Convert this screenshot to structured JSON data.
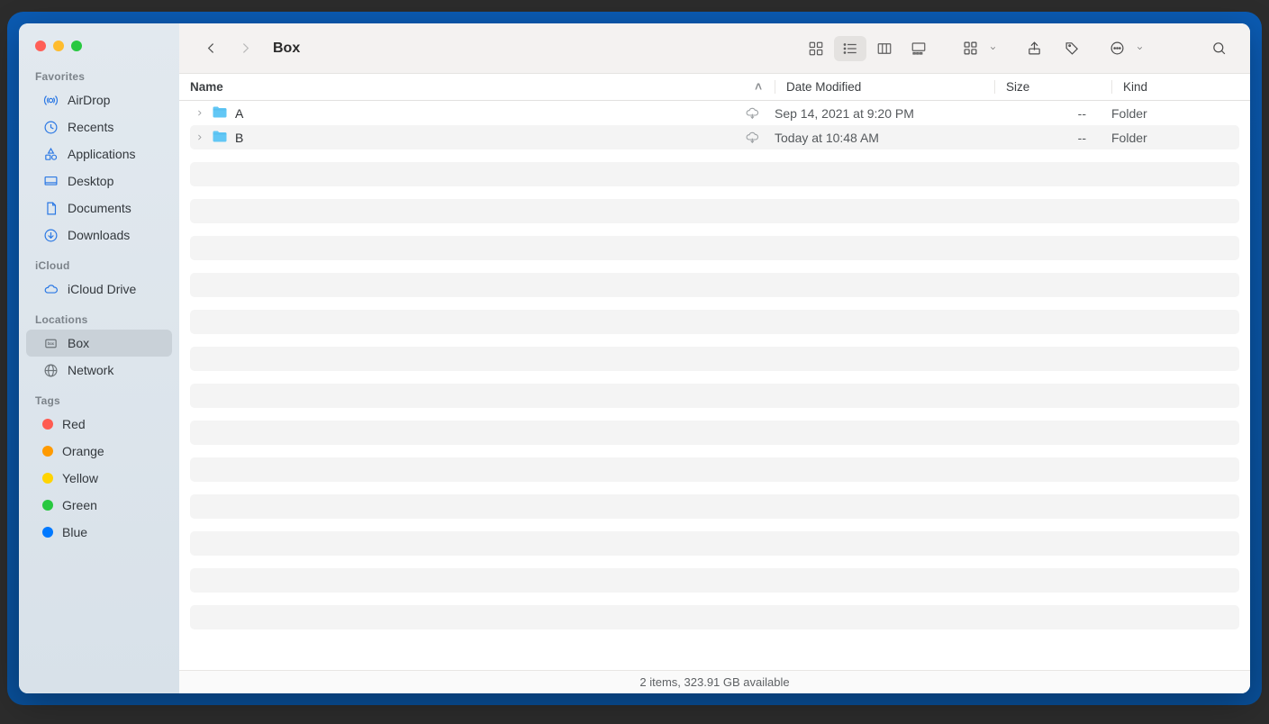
{
  "window_title": "Box",
  "sidebar": {
    "sections": [
      {
        "label": "Favorites",
        "items": [
          {
            "id": "airdrop",
            "label": "AirDrop",
            "icon": "airdrop-icon"
          },
          {
            "id": "recents",
            "label": "Recents",
            "icon": "clock-icon"
          },
          {
            "id": "applications",
            "label": "Applications",
            "icon": "applications-icon"
          },
          {
            "id": "desktop",
            "label": "Desktop",
            "icon": "desktop-icon"
          },
          {
            "id": "documents",
            "label": "Documents",
            "icon": "document-icon"
          },
          {
            "id": "downloads",
            "label": "Downloads",
            "icon": "download-icon"
          }
        ]
      },
      {
        "label": "iCloud",
        "items": [
          {
            "id": "icloud-drive",
            "label": "iCloud Drive",
            "icon": "cloud-icon"
          }
        ]
      },
      {
        "label": "Locations",
        "items": [
          {
            "id": "box",
            "label": "Box",
            "icon": "box-icon",
            "selected": true
          },
          {
            "id": "network",
            "label": "Network",
            "icon": "network-icon"
          }
        ]
      },
      {
        "label": "Tags",
        "items": [
          {
            "id": "tag-red",
            "label": "Red",
            "color": "#ff5b51"
          },
          {
            "id": "tag-orange",
            "label": "Orange",
            "color": "#ff9a00"
          },
          {
            "id": "tag-yellow",
            "label": "Yellow",
            "color": "#ffd400"
          },
          {
            "id": "tag-green",
            "label": "Green",
            "color": "#28c840"
          },
          {
            "id": "tag-blue",
            "label": "Blue",
            "color": "#0079ff"
          }
        ]
      }
    ]
  },
  "columns": {
    "name": "Name",
    "date": "Date Modified",
    "size": "Size",
    "kind": "Kind",
    "sort_indicator": "˄"
  },
  "files": [
    {
      "name": "A",
      "date": "Sep 14, 2021 at 9:20 PM",
      "size": "--",
      "kind": "Folder",
      "cloud": true
    },
    {
      "name": "B",
      "date": "Today at 10:48 AM",
      "size": "--",
      "kind": "Folder",
      "cloud": true
    }
  ],
  "status_bar": "2 items, 323.91 GB available"
}
